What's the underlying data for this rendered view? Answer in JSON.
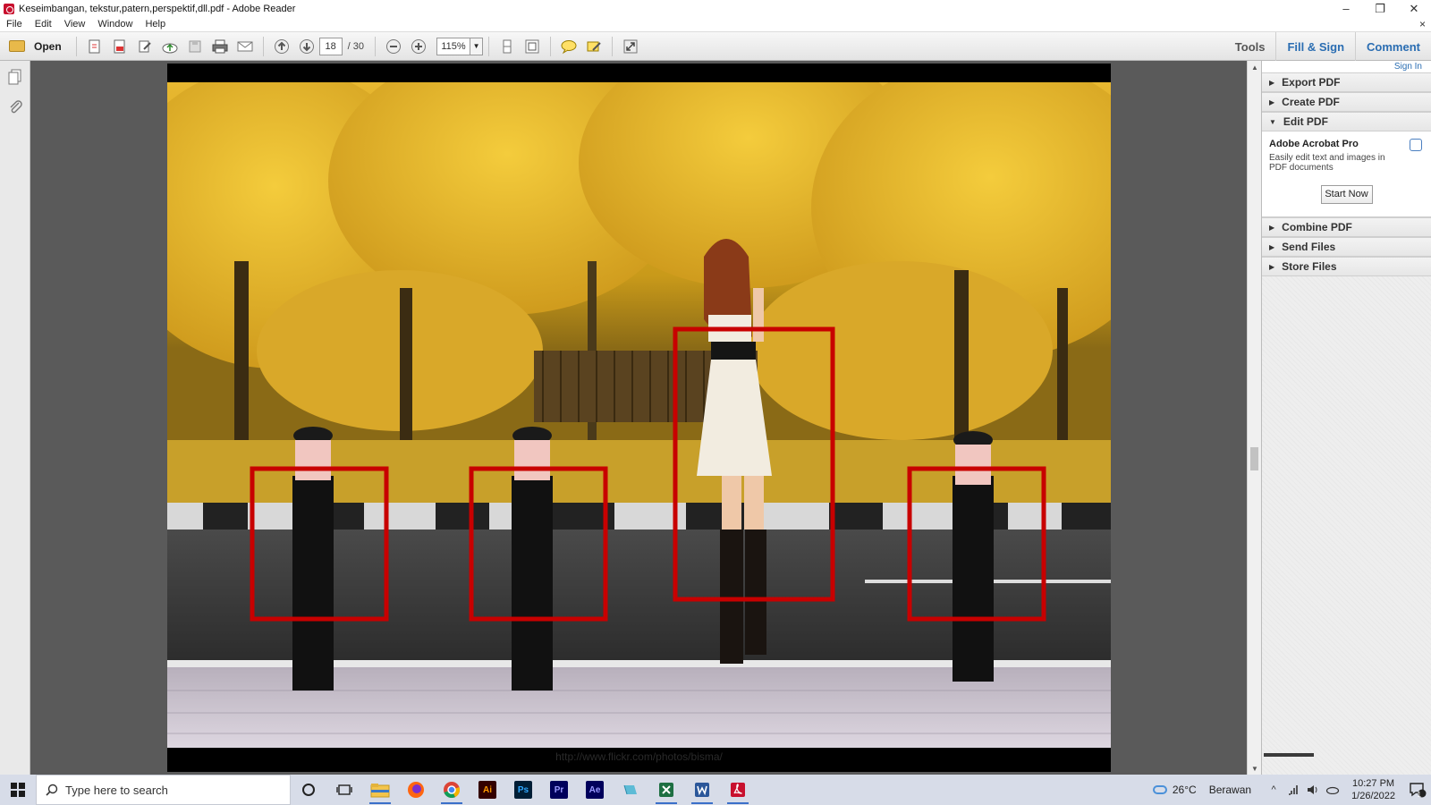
{
  "window": {
    "title": "Keseimbangan, tekstur,patern,perspektif,dll.pdf - Adobe Reader",
    "controls": [
      "–",
      "❐",
      "✕"
    ]
  },
  "menu": {
    "items": [
      "File",
      "Edit",
      "View",
      "Window",
      "Help"
    ],
    "doc_close": "×"
  },
  "toolbar": {
    "open_label": "Open",
    "current_page": "18",
    "total_pages": "/ 30",
    "zoom": "115%",
    "tabs": {
      "tools": "Tools",
      "fill_sign": "Fill & Sign",
      "comment": "Comment"
    }
  },
  "document": {
    "credit": "http://www.flickr.com/photos/bisma/"
  },
  "right_pane": {
    "sign_in": "Sign In",
    "items_top": [
      "Export PDF",
      "Create PDF"
    ],
    "edit_pdf": "Edit PDF",
    "edit_panel": {
      "heading": "Adobe Acrobat Pro",
      "description": "Easily edit text and images in PDF documents",
      "button": "Start Now"
    },
    "items_bottom": [
      "Combine PDF",
      "Send Files",
      "Store Files"
    ]
  },
  "taskbar": {
    "search_placeholder": "Type here to search",
    "weather_temp": "26°C",
    "weather_desc": "Berawan",
    "time": "10:27 PM",
    "date": "1/26/2022",
    "notification_count": "1",
    "apps": [
      {
        "name": "Ai",
        "color": "#ff9a00",
        "bg": "#330000"
      },
      {
        "name": "Ps",
        "color": "#31a8ff",
        "bg": "#001e36"
      },
      {
        "name": "Pr",
        "color": "#9999ff",
        "bg": "#00005b"
      },
      {
        "name": "Ae",
        "color": "#9999ff",
        "bg": "#00005b"
      }
    ]
  }
}
